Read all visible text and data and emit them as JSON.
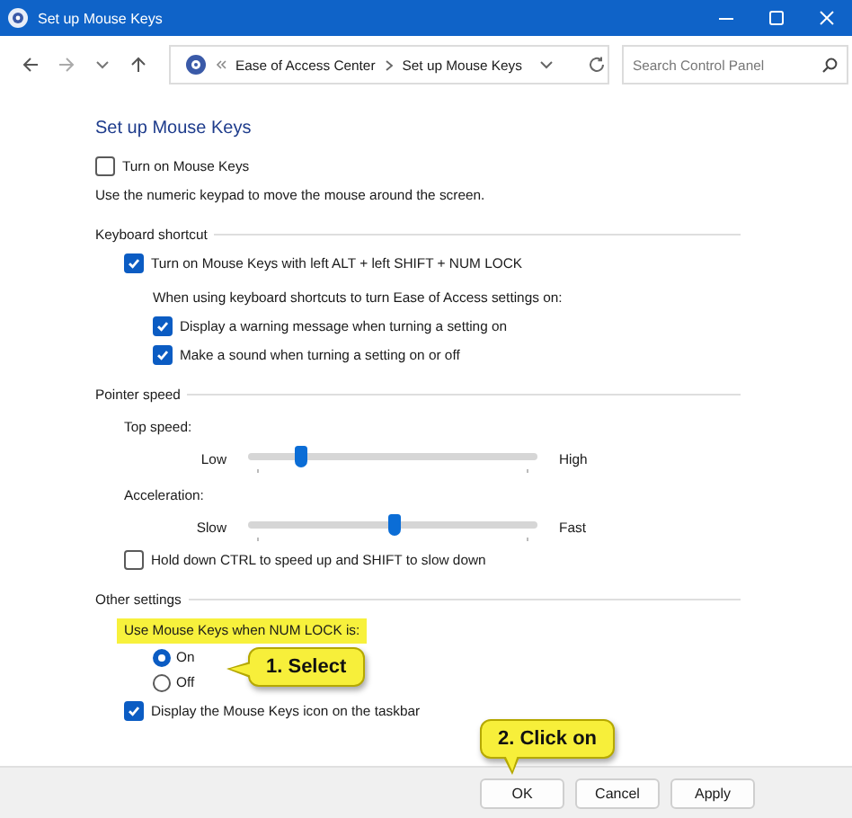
{
  "window": {
    "title": "Set up Mouse Keys"
  },
  "address_bar": {
    "breadcrumbs": [
      "Ease of Access Center",
      "Set up Mouse Keys"
    ]
  },
  "search": {
    "placeholder": "Search Control Panel"
  },
  "heading": "Set up Mouse Keys",
  "sections": [
    {
      "items": [
        {
          "kind": "checkbox",
          "label": "Turn on Mouse Keys",
          "checked": false
        },
        {
          "kind": "note",
          "text": "Use the numeric keypad to move the mouse around the screen."
        }
      ]
    },
    {
      "title": "Keyboard shortcut",
      "items": [
        {
          "kind": "checkbox",
          "label": "Turn on Mouse Keys with left ALT + left SHIFT + NUM LOCK",
          "checked": true,
          "children": [
            {
              "kind": "note",
              "text": "When using keyboard shortcuts to turn Ease of Access settings on:"
            },
            {
              "kind": "checkbox",
              "label": "Display a warning message when turning a setting on",
              "checked": true
            },
            {
              "kind": "checkbox",
              "label": "Make a sound when turning a setting on or off",
              "checked": true
            }
          ]
        }
      ]
    },
    {
      "title": "Pointer speed",
      "items": [
        {
          "kind": "slider",
          "label": "Top speed:",
          "min_label": "Low",
          "max_label": "High",
          "level": 0.18
        },
        {
          "kind": "slider",
          "label": "Acceleration:",
          "min_label": "Slow",
          "max_label": "Fast",
          "level": 0.5
        },
        {
          "kind": "checkbox",
          "label": "Hold down CTRL to speed up and SHIFT to slow down",
          "checked": false
        }
      ]
    },
    {
      "title": "Other settings",
      "items": [
        {
          "kind": "radio_group",
          "label": "Use Mouse Keys when NUM LOCK is:",
          "highlighted": true,
          "callout": "1. Select",
          "options": [
            {
              "label": "On",
              "selected": true
            },
            {
              "label": "Off",
              "selected": false
            }
          ]
        },
        {
          "kind": "checkbox",
          "label": "Display the Mouse Keys icon on the taskbar",
          "checked": true
        }
      ]
    }
  ],
  "buttons": [
    {
      "label": "OK",
      "callout": "2. Click on"
    },
    {
      "label": "Cancel"
    },
    {
      "label": "Apply"
    }
  ]
}
